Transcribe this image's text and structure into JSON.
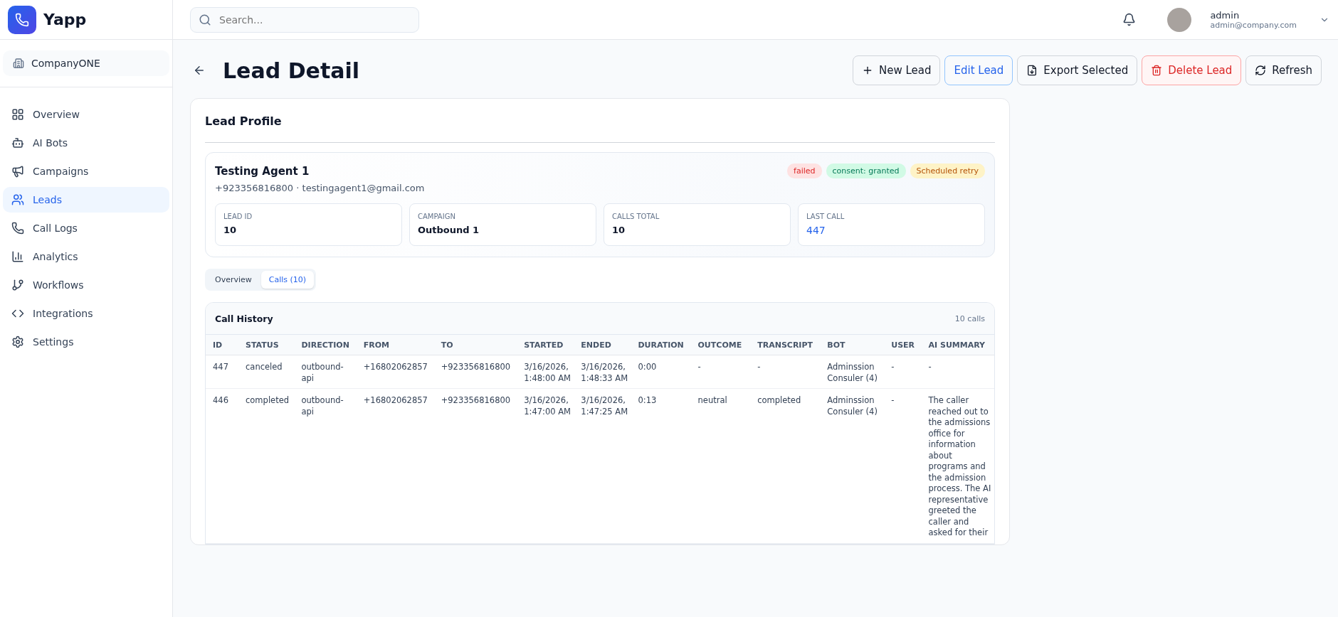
{
  "app": {
    "name": "Yapp"
  },
  "search": {
    "placeholder": "Search..."
  },
  "user": {
    "name": "admin",
    "email": "admin@company.com"
  },
  "company": "CompanyONE",
  "nav": [
    {
      "label": "Overview",
      "selected": false
    },
    {
      "label": "AI Bots",
      "selected": false
    },
    {
      "label": "Campaigns",
      "selected": false
    },
    {
      "label": "Leads",
      "selected": true
    },
    {
      "label": "Call Logs",
      "selected": false
    },
    {
      "label": "Analytics",
      "selected": false
    },
    {
      "label": "Workflows",
      "selected": false
    },
    {
      "label": "Integrations",
      "selected": false
    },
    {
      "label": "Settings",
      "selected": false
    }
  ],
  "page": {
    "title": "Lead Detail"
  },
  "actions": [
    {
      "label": "New Lead",
      "kind": "plus"
    },
    {
      "label": "Edit Lead",
      "kind": "primary"
    },
    {
      "label": "Export Selected",
      "kind": "export"
    },
    {
      "label": "Delete Lead",
      "kind": "danger"
    },
    {
      "label": "Refresh",
      "kind": "refresh"
    }
  ],
  "profile": {
    "title": "Lead Profile",
    "name": "Testing Agent 1",
    "contact": "+923356816800 · testingagent1@gmail.com",
    "tags": [
      {
        "label": "failed",
        "color": "#fee2e2"
      },
      {
        "label": "consent: granted",
        "color": "#d1fae5"
      },
      {
        "label": "Scheduled retry",
        "color": "#fef3c7"
      }
    ],
    "stats": [
      {
        "label": "LEAD ID",
        "value": "10",
        "kind": "text"
      },
      {
        "label": "CAMPAIGN",
        "value": "Outbound 1",
        "kind": "text"
      },
      {
        "label": "CALLS TOTAL",
        "value": "10",
        "kind": "text"
      },
      {
        "label": "LAST CALL",
        "value": "447",
        "kind": "link"
      }
    ]
  },
  "tabs": [
    {
      "label": "Overview",
      "selected": false
    },
    {
      "label": "Calls (10)",
      "selected": true
    }
  ],
  "call_history": {
    "title": "Call History",
    "count": "10 calls",
    "columns": [
      "ID",
      "STATUS",
      "DIRECTION",
      "FROM",
      "TO",
      "STARTED",
      "ENDED",
      "DURATION",
      "OUTCOME",
      "TRANSCRIPT",
      "BOT",
      "USER",
      "AI SUMMARY"
    ],
    "rows": [
      [
        "447",
        "canceled",
        "outbound-api",
        "+16802062857",
        "+923356816800",
        "3/16/2026, 1:48:00 AM",
        "3/16/2026, 1:48:33 AM",
        "0:00",
        "-",
        "-",
        "Adminssion Consuler (4)",
        "-",
        "-"
      ],
      [
        "446",
        "completed",
        "outbound-api",
        "+16802062857",
        "+923356816800",
        "3/16/2026, 1:47:00 AM",
        "3/16/2026, 1:47:25 AM",
        "0:13",
        "neutral",
        "completed",
        "Adminssion Consuler (4)",
        "-",
        "The caller reached out to the admissions office for information about programs and the admission process. The AI representative greeted the caller and asked for their"
      ]
    ]
  }
}
